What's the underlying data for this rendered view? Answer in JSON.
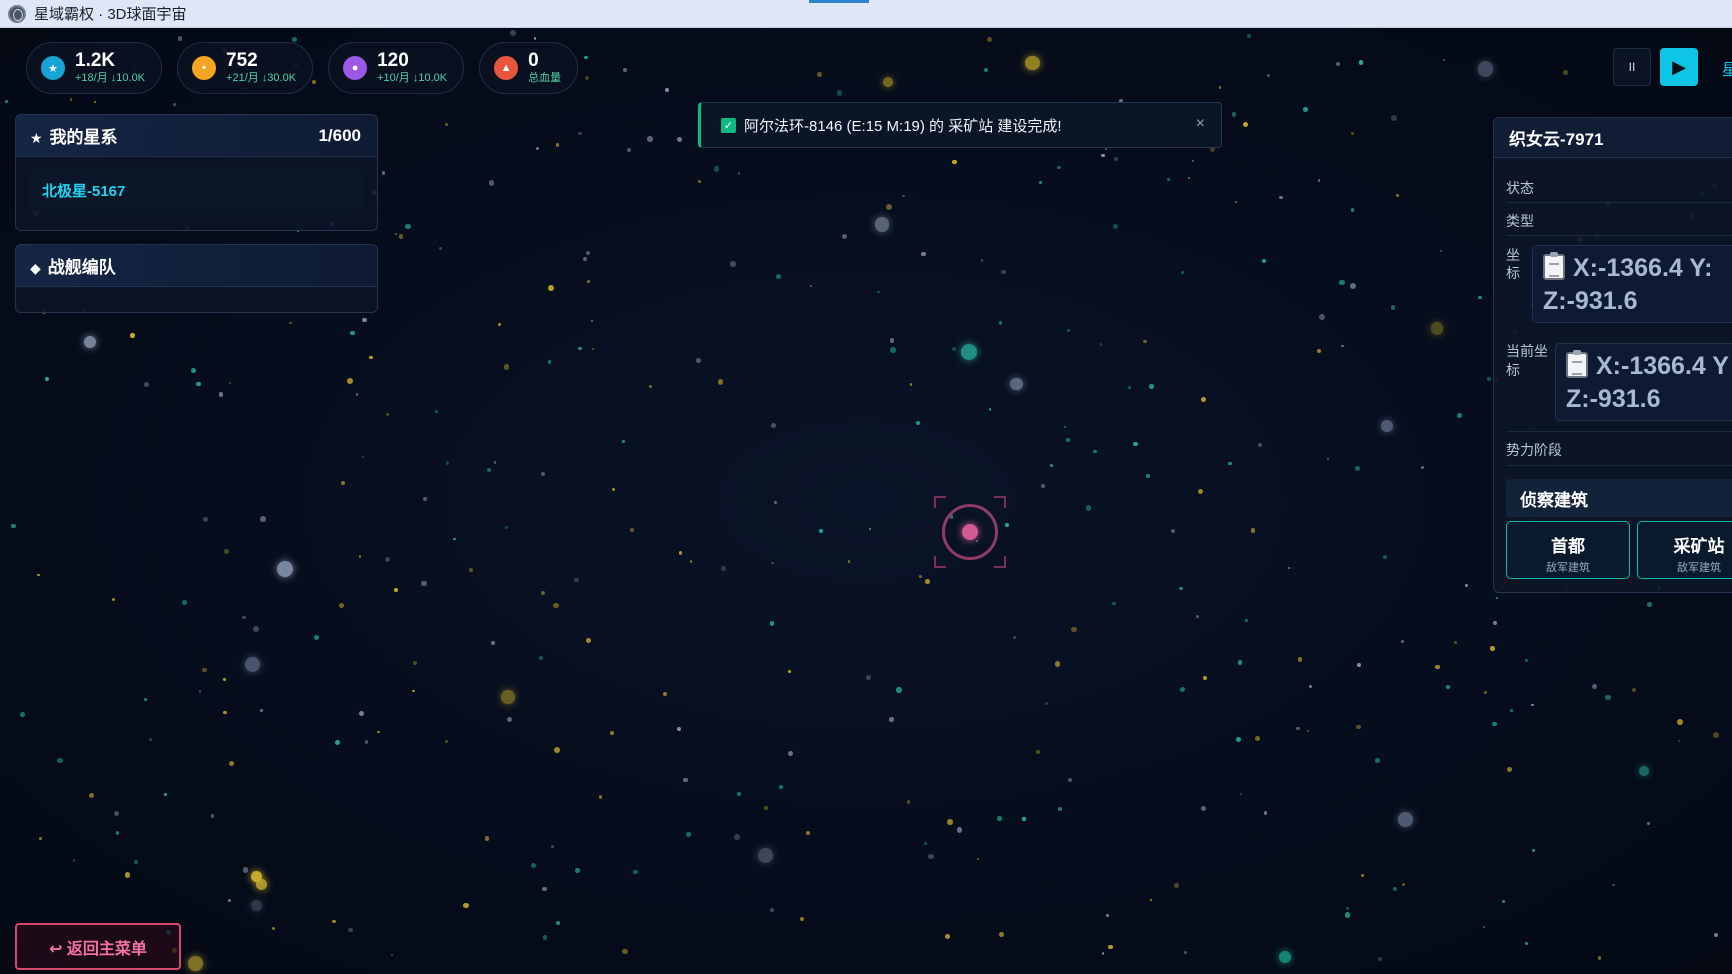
{
  "window": {
    "title": "星域霸权 · 3D球面宇宙"
  },
  "resources": [
    {
      "icon": "star-icon",
      "color": "#16a3d6",
      "amount": "1.2K",
      "rate": "+18/月 ↓10.0K"
    },
    {
      "icon": "coin-icon",
      "color": "#f5a524",
      "amount": "752",
      "rate": "+21/月 ↓30.0K"
    },
    {
      "icon": "gem-icon",
      "color": "#9b59e6",
      "amount": "120",
      "rate": "+10/月 ↓10.0K"
    },
    {
      "icon": "triangle-icon",
      "color": "#e8553c",
      "amount": "0",
      "rate": "总血量"
    }
  ],
  "controls": {
    "pause_icon": "II",
    "play_icon": "▶",
    "edge_glyph": "星"
  },
  "my_systems": {
    "title": "我的星系",
    "count": "1/600",
    "items": [
      "北极星-5167"
    ]
  },
  "fleet": {
    "title": "战舰编队"
  },
  "toast": {
    "message": "阿尔法环-8146 (E:15 M:19) 的 采矿站 建设完成!",
    "close": "×"
  },
  "detail": {
    "name": "织女云-7971",
    "status_label": "状态",
    "type_label": "类型",
    "coord_label": "坐标",
    "coord_line1": "X:-1366.4 Y:",
    "coord_line2": "Z:-931.6",
    "current_coord_label": "当前坐标",
    "current_line1": "X:-1366.4 Y",
    "current_line2": "Z:-931.6",
    "power_stage_label": "势力阶段",
    "recon_title": "侦察建筑",
    "buildings": [
      {
        "name": "首都",
        "sub": "敌军建筑"
      },
      {
        "name": "采矿站",
        "sub": "敌军建筑"
      }
    ]
  },
  "back_button": "↩ 返回主菜单",
  "colors": {
    "accent": "#0fc5e6",
    "success": "#10b981",
    "danger": "#d9476e",
    "target": "#d15c93"
  }
}
